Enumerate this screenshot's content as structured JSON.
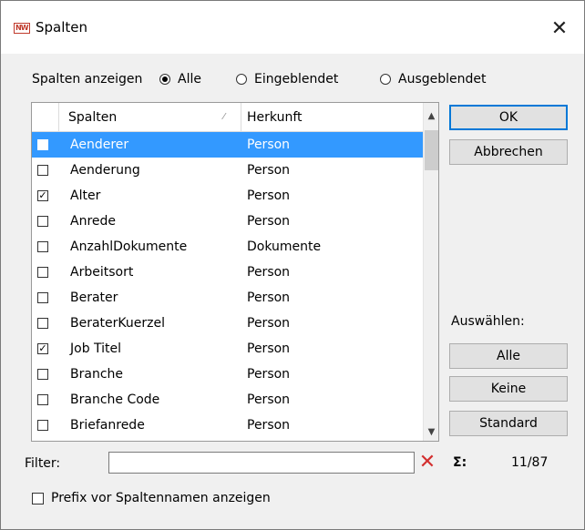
{
  "window": {
    "title": "Spalten",
    "icon_text": "NW"
  },
  "show_columns": {
    "label": "Spalten anzeigen",
    "options": [
      {
        "label": "Alle",
        "selected": true
      },
      {
        "label": "Eingeblendet",
        "selected": false
      },
      {
        "label": "Ausgeblendet",
        "selected": false
      }
    ]
  },
  "table": {
    "headers": {
      "name": "Spalten",
      "source": "Herkunft"
    },
    "rows": [
      {
        "name": "Aenderer",
        "source": "Person",
        "checked": false,
        "selected": true
      },
      {
        "name": "Aenderung",
        "source": "Person",
        "checked": false,
        "selected": false
      },
      {
        "name": "Alter",
        "source": "Person",
        "checked": true,
        "selected": false
      },
      {
        "name": "Anrede",
        "source": "Person",
        "checked": false,
        "selected": false
      },
      {
        "name": "AnzahlDokumente",
        "source": "Dokumente",
        "checked": false,
        "selected": false
      },
      {
        "name": "Arbeitsort",
        "source": "Person",
        "checked": false,
        "selected": false
      },
      {
        "name": "Berater",
        "source": "Person",
        "checked": false,
        "selected": false
      },
      {
        "name": "BeraterKuerzel",
        "source": "Person",
        "checked": false,
        "selected": false
      },
      {
        "name": "Job Titel",
        "source": "Person",
        "checked": true,
        "selected": false
      },
      {
        "name": "Branche",
        "source": "Person",
        "checked": false,
        "selected": false
      },
      {
        "name": "Branche Code",
        "source": "Person",
        "checked": false,
        "selected": false
      },
      {
        "name": "Briefanrede",
        "source": "Person",
        "checked": false,
        "selected": false
      }
    ]
  },
  "buttons": {
    "ok": "OK",
    "cancel": "Abbrechen",
    "select_label": "Auswählen:",
    "all": "Alle",
    "none": "Keine",
    "standard": "Standard"
  },
  "filter": {
    "label": "Filter:",
    "value": ""
  },
  "summary": {
    "sigma": "Σ:",
    "count": "11/87"
  },
  "prefix_option": {
    "label": "Prefix vor Spaltennamen anzeigen",
    "checked": false
  }
}
